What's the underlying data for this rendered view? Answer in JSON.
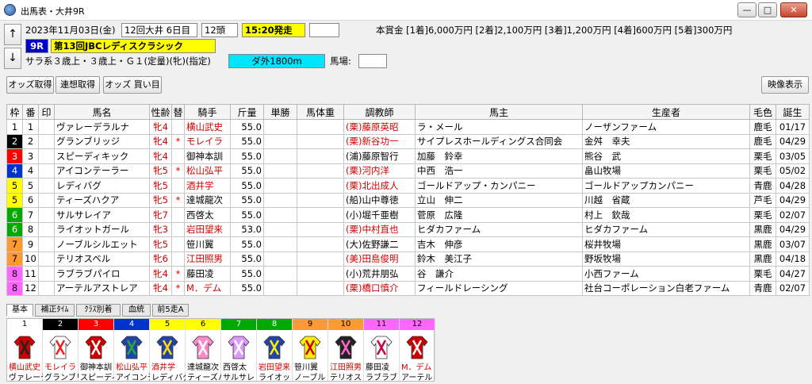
{
  "window": {
    "title": "出馬表・大井9R"
  },
  "header": {
    "date": "2023年11月03日(金)",
    "kai": "12回大井 6日目",
    "heads": "12頭",
    "post_time": "15:20発走",
    "extra": "",
    "race_no": "9R",
    "race_name": "第13回JBCレディスクラシック",
    "conditions": "サラ系３歳上・３歳上・Ｇ１(定量)(牝)(指定)",
    "course": "ダ外1800m",
    "baba_label": "馬場:",
    "baba_value": "",
    "prize": "本賞金 [1着]6,000万円 [2着]2,100万円 [3着]1,200万円 [4着]600万円 [5着]300万円",
    "up": "↑",
    "down": "↓"
  },
  "toolbar": {
    "odds": "オッズ取得",
    "renso": "連想取得",
    "kaime": "オッズ 買い目",
    "video": "映像表示"
  },
  "columns": [
    "枠",
    "番",
    "印",
    "馬名",
    "性齢",
    "替",
    "騎手",
    "斤量",
    "単勝",
    "馬体重",
    "調教師",
    "馬主",
    "生産者",
    "毛色",
    "誕生"
  ],
  "frame_colors": [
    "#ffffff",
    "#000000",
    "#ff0000",
    "#0033cc",
    "#ffff00",
    "#ffff00",
    "#00aa00",
    "#00aa00",
    "#ff9933",
    "#ff9933",
    "#ff66ff",
    "#ff66ff"
  ],
  "rows": [
    {
      "waku": "1",
      "ban": "1",
      "name": "ヴァレーデラルナ",
      "sex": "牝4",
      "kae": "",
      "jockey": "横山武史",
      "jred": true,
      "kin": "55.0",
      "trainer": "(栗)藤原英昭",
      "tred": true,
      "owner": "ラ・メール",
      "breeder": "ノーザンファーム",
      "color": "鹿毛",
      "birth": "01/17"
    },
    {
      "waku": "2",
      "ban": "2",
      "name": "グランブリッジ",
      "sex": "牝4",
      "kae": "*",
      "jockey": "モレイラ",
      "jred": true,
      "kin": "55.0",
      "trainer": "(栗)新谷功一",
      "tred": true,
      "owner": "サイプレスホールディングス合同会",
      "breeder": "金舛　幸夫",
      "color": "鹿毛",
      "birth": "04/29"
    },
    {
      "waku": "3",
      "ban": "3",
      "name": "スピーディキック",
      "sex": "牝4",
      "kae": "",
      "jockey": "御神本訓",
      "jred": false,
      "kin": "55.0",
      "trainer": "(浦)藤原智行",
      "tred": false,
      "owner": "加藤　鈴幸",
      "breeder": "熊谷　武",
      "color": "栗毛",
      "birth": "03/05"
    },
    {
      "waku": "4",
      "ban": "4",
      "name": "アイコンテーラー",
      "sex": "牝5",
      "kae": "*",
      "jockey": "松山弘平",
      "jred": true,
      "kin": "55.0",
      "trainer": "(栗)河内洋",
      "tred": true,
      "owner": "中西　浩一",
      "breeder": "畠山牧場",
      "color": "栗毛",
      "birth": "05/02"
    },
    {
      "waku": "5",
      "ban": "5",
      "name": "レディバグ",
      "sex": "牝5",
      "kae": "",
      "jockey": "酒井学",
      "jred": true,
      "kin": "55.0",
      "trainer": "(栗)北出成人",
      "tred": true,
      "owner": "ゴールドアップ・カンパニー",
      "breeder": "ゴールドアップカンパニー",
      "color": "青鹿",
      "birth": "04/28"
    },
    {
      "waku": "5",
      "ban": "6",
      "name": "ティーズハクア",
      "sex": "牝5",
      "kae": "*",
      "jockey": "達城龍次",
      "jred": false,
      "kin": "55.0",
      "trainer": "(船)山中尊徳",
      "tred": false,
      "owner": "立山　伸二",
      "breeder": "川越　省蔵",
      "color": "芦毛",
      "birth": "04/29"
    },
    {
      "waku": "6",
      "ban": "7",
      "name": "サルサレイア",
      "sex": "牝7",
      "kae": "",
      "jockey": "西啓太",
      "jred": false,
      "kin": "55.0",
      "trainer": "(小)堀千亜樹",
      "tred": false,
      "owner": "菅原　広隆",
      "breeder": "村上　欽哉",
      "color": "栗毛",
      "birth": "02/07"
    },
    {
      "waku": "6",
      "ban": "8",
      "name": "ライオットガール",
      "sex": "牝3",
      "kae": "",
      "jockey": "岩田望来",
      "jred": true,
      "kin": "53.0",
      "trainer": "(栗)中村直也",
      "tred": true,
      "owner": "ヒダカファーム",
      "breeder": "ヒダカファーム",
      "color": "黒鹿",
      "birth": "04/29"
    },
    {
      "waku": "7",
      "ban": "9",
      "name": "ノーブルシルエット",
      "sex": "牝5",
      "kae": "",
      "jockey": "笹川翼",
      "jred": false,
      "kin": "55.0",
      "trainer": "(大)佐野謙二",
      "tred": false,
      "owner": "吉木　伸彦",
      "breeder": "桜井牧場",
      "color": "黒鹿",
      "birth": "03/07"
    },
    {
      "waku": "7",
      "ban": "10",
      "name": "テリオスベル",
      "sex": "牝6",
      "kae": "",
      "jockey": "江田照男",
      "jred": true,
      "kin": "55.0",
      "trainer": "(美)田島俊明",
      "tred": true,
      "owner": "鈴木　美江子",
      "breeder": "野坂牧場",
      "color": "黒鹿",
      "birth": "04/18"
    },
    {
      "waku": "8",
      "ban": "11",
      "name": "ラブラブパイロ",
      "sex": "牝4",
      "kae": "*",
      "jockey": "藤田凌",
      "jred": false,
      "kin": "55.0",
      "trainer": "(小)荒井朋弘",
      "tred": false,
      "owner": "谷　謙介",
      "breeder": "小西ファーム",
      "color": "栗毛",
      "birth": "04/27"
    },
    {
      "waku": "8",
      "ban": "12",
      "name": "アーテルアストレア",
      "sex": "牝4",
      "kae": "*",
      "jockey": "M．デム",
      "jred": true,
      "kin": "55.0",
      "trainer": "(栗)橋口慎介",
      "tred": true,
      "owner": "フィールドレーシング",
      "breeder": "社台コーポレーション白老ファーム",
      "color": "青鹿",
      "birth": "02/07"
    }
  ],
  "tabs": [
    "基本",
    "補正ﾀｲﾑ",
    "ｸﾗｽ別着",
    "血統",
    "前5走A"
  ],
  "silks": [
    {
      "num": "1",
      "jockey": "横山武史",
      "horse": "ヴァレーデラ",
      "jred": true
    },
    {
      "num": "2",
      "jockey": "モレイラ",
      "horse": "グランブリッジ",
      "jred": true
    },
    {
      "num": "3",
      "jockey": "御神本訓",
      "horse": "スピーディキ",
      "jred": false
    },
    {
      "num": "4",
      "jockey": "松山弘平",
      "horse": "アイコンテ",
      "jred": true
    },
    {
      "num": "5",
      "jockey": "酒井学",
      "horse": "レディバグ",
      "jred": true
    },
    {
      "num": "6",
      "jockey": "達城龍次",
      "horse": "ティーズハ",
      "jred": false
    },
    {
      "num": "7",
      "jockey": "西啓太",
      "horse": "サルサレ",
      "jred": false
    },
    {
      "num": "8",
      "jockey": "岩田望来",
      "horse": "ライオッ",
      "jred": true
    },
    {
      "num": "9",
      "jockey": "笹川翼",
      "horse": "ノーブル",
      "jred": false
    },
    {
      "num": "10",
      "jockey": "江田照男",
      "horse": "テリオス",
      "jred": true
    },
    {
      "num": "11",
      "jockey": "藤田凌",
      "horse": "ラブラブ",
      "jred": false
    },
    {
      "num": "12",
      "jockey": "M．デム",
      "horse": "アーテル",
      "jred": true
    }
  ]
}
